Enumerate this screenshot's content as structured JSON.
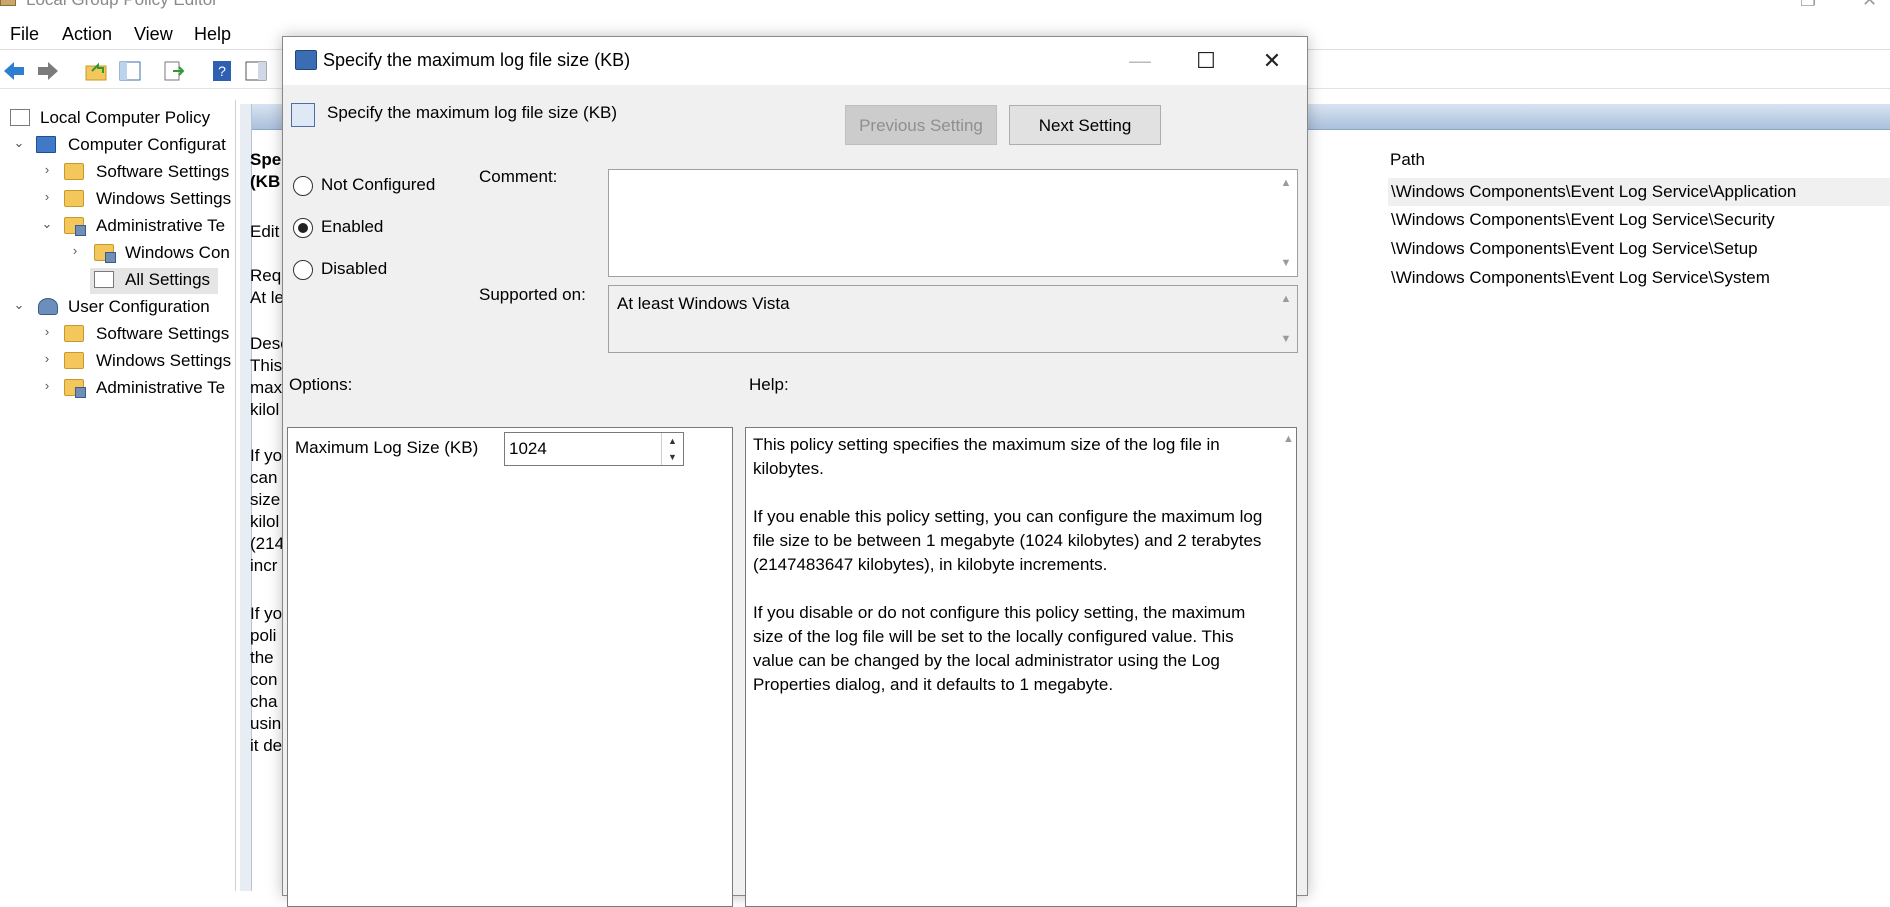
{
  "main_window": {
    "title": "Local Group Policy Editor",
    "menu": [
      "File",
      "Action",
      "View",
      "Help"
    ],
    "tree": [
      {
        "label": "Local Computer Policy"
      },
      {
        "label": "Computer Configurat"
      },
      {
        "label": "Software Settings"
      },
      {
        "label": "Windows Settings"
      },
      {
        "label": "Administrative Te"
      },
      {
        "label": "Windows Con"
      },
      {
        "label": "All Settings"
      },
      {
        "label": "User Configuration"
      },
      {
        "label": "Software Settings"
      },
      {
        "label": "Windows Settings"
      },
      {
        "label": "Administrative Te"
      }
    ],
    "extended_text": [
      "Spe",
      "(KB",
      "Edit",
      "Req",
      "At le",
      "Desc",
      "This",
      "max",
      "kilol",
      "If yo",
      "can",
      "size",
      "kilol",
      "(214",
      "incr",
      "If yo",
      "poli",
      "the",
      "con",
      "cha",
      "usin",
      "it de"
    ],
    "path_header": "Path",
    "paths": [
      "\\Windows Components\\Event Log Service\\Application",
      "\\Windows Components\\Event Log Service\\Security",
      "\\Windows Components\\Event Log Service\\Setup",
      "\\Windows Components\\Event Log Service\\System"
    ]
  },
  "dialog": {
    "title": "Specify the maximum log file size (KB)",
    "heading": "Specify the maximum log file size (KB)",
    "prev_button": "Previous Setting",
    "next_button": "Next Setting",
    "radios": [
      {
        "label": "Not Configured",
        "checked": false
      },
      {
        "label": "Enabled",
        "checked": true
      },
      {
        "label": "Disabled",
        "checked": false
      }
    ],
    "comment_label": "Comment:",
    "supported_label": "Supported on:",
    "supported_value": "At least Windows Vista",
    "options_label": "Options:",
    "help_label": "Help:",
    "option_field_label": "Maximum Log Size (KB)",
    "option_field_value": "1024",
    "help_paragraphs": [
      "This policy setting specifies the maximum size of the log file in kilobytes.",
      "If you enable this policy setting, you can configure the maximum log file size to be between 1 megabyte (1024 kilobytes) and 2 terabytes (2147483647 kilobytes), in kilobyte increments.",
      "If you disable or do not configure this policy setting, the maximum size of the log file will be set to the locally configured value. This value can be changed by the local administrator using the Log Properties dialog, and it defaults to 1 megabyte."
    ]
  }
}
